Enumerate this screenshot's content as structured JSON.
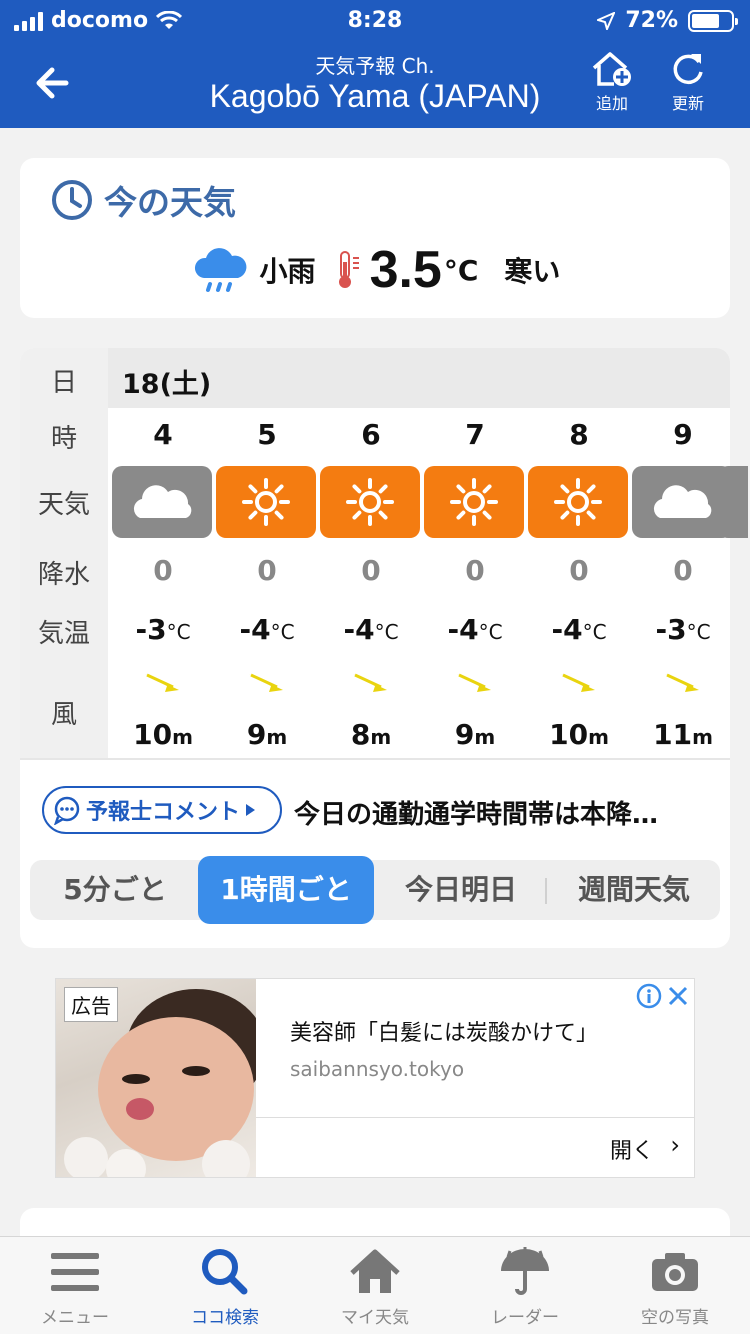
{
  "status_bar": {
    "carrier": "docomo",
    "time": "8:28",
    "battery": "72%"
  },
  "nav": {
    "subtitle": "天気予報 Ch.",
    "title": "Kagobō Yama (JAPAN)",
    "add_label": "追加",
    "refresh_label": "更新"
  },
  "now": {
    "heading": "今の天気",
    "condition": "小雨",
    "temperature": "3.5",
    "unit": "°C",
    "feel": "寒い"
  },
  "forecast": {
    "labels": {
      "day": "日",
      "hour": "時",
      "weather": "天気",
      "precip": "降水",
      "temp": "気温",
      "wind": "風"
    },
    "date": "18(土)",
    "hours": [
      {
        "hour": "4",
        "weather": "cloudy",
        "precip": "0",
        "temp": "-3",
        "wind": "10"
      },
      {
        "hour": "5",
        "weather": "sunny",
        "precip": "0",
        "temp": "-4",
        "wind": "9"
      },
      {
        "hour": "6",
        "weather": "sunny",
        "precip": "0",
        "temp": "-4",
        "wind": "8"
      },
      {
        "hour": "7",
        "weather": "sunny",
        "precip": "0",
        "temp": "-4",
        "wind": "9"
      },
      {
        "hour": "8",
        "weather": "sunny",
        "precip": "0",
        "temp": "-4",
        "wind": "10"
      },
      {
        "hour": "9",
        "weather": "cloudy",
        "precip": "0",
        "temp": "-3",
        "wind": "11"
      }
    ],
    "temp_unit": "°C",
    "wind_unit": "m",
    "comment_button": "予報士コメント",
    "comment_text": "今日の通勤通学時間帯は本降…",
    "tabs": [
      "5分ごと",
      "1時間ごと",
      "今日明日",
      "週間天気"
    ],
    "colors": {
      "sunny": "#f47c11",
      "cloudy": "#8a8a8a",
      "accent": "#1f5bbf",
      "active_tab": "#3a8dea",
      "wind_arrow": "#e9d40f"
    }
  },
  "ad": {
    "badge": "広告",
    "title": "美容師「白髪には炭酸かけて」",
    "domain": "saibannsyo.tokyo",
    "open_label": "開く",
    "chevron": "›"
  },
  "tabbar": [
    {
      "label": "メニュー",
      "icon": "menu-icon"
    },
    {
      "label": "ココ検索",
      "icon": "search-icon"
    },
    {
      "label": "マイ天気",
      "icon": "home-icon"
    },
    {
      "label": "レーダー",
      "icon": "umbrella-icon"
    },
    {
      "label": "空の写真",
      "icon": "camera-icon"
    }
  ]
}
